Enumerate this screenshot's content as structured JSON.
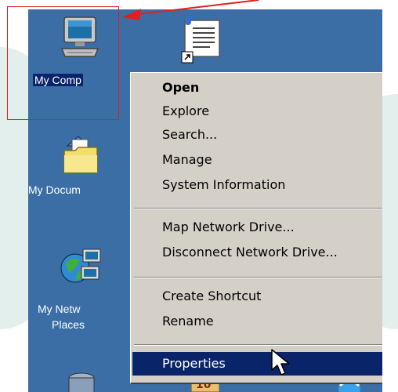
{
  "desktop": {
    "icons": [
      {
        "label": "My Comp",
        "icon": "my-computer-icon",
        "selected": true
      },
      {
        "label": "My Docum",
        "icon": "my-documents-folder-icon"
      },
      {
        "label": "My Netw",
        "label2": "Places",
        "icon": "my-network-places-icon"
      },
      {
        "icon": "recycle-bin-icon"
      },
      {
        "icon": "shortcut-document-icon"
      },
      {
        "icon": "bottom-app-icon"
      },
      {
        "icon": "internet-explorer-icon"
      }
    ]
  },
  "context_menu": {
    "items": [
      {
        "label": "Open",
        "bold": true
      },
      {
        "label": "Explore"
      },
      {
        "label": "Search..."
      },
      {
        "label": "Manage"
      },
      {
        "label": "System Information"
      },
      {
        "label": "Map Network Drive..."
      },
      {
        "label": "Disconnect Network Drive..."
      },
      {
        "label": "Create Shortcut"
      },
      {
        "label": "Rename"
      },
      {
        "label": "Properties",
        "highlighted": true
      }
    ]
  },
  "colors": {
    "desktop": "#3a6ea5",
    "menu_bg": "#d4d0c8",
    "highlight": "#0a246a",
    "annotation": "#e02020"
  }
}
